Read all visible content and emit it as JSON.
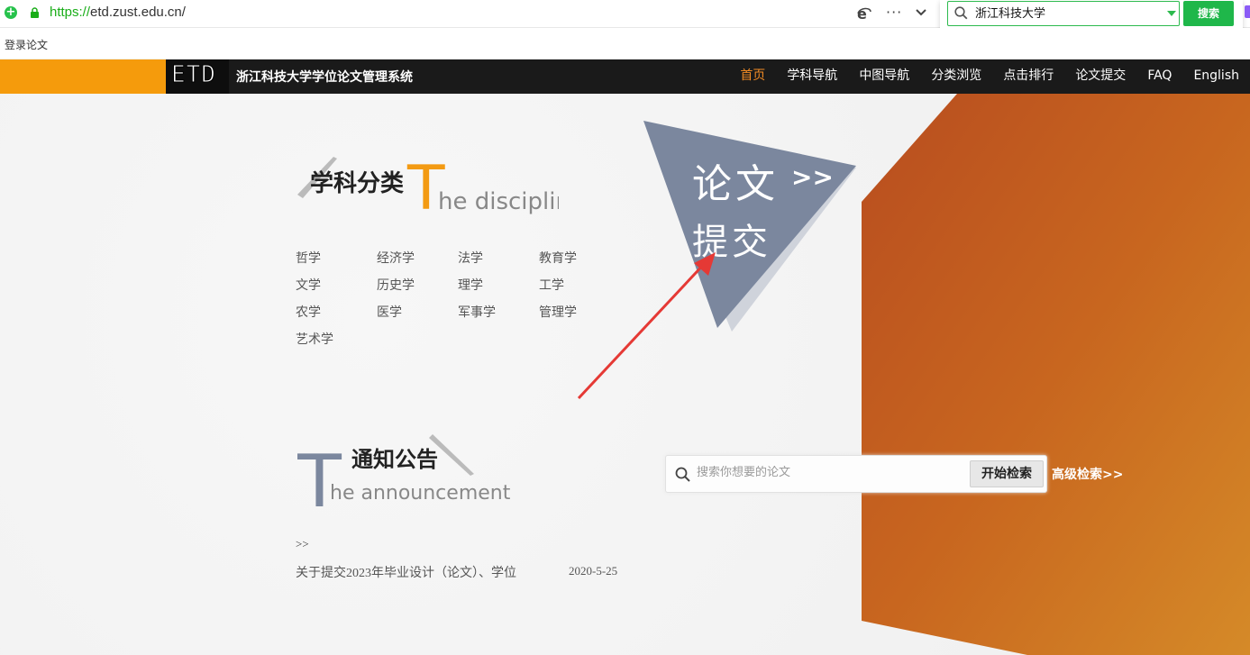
{
  "browser": {
    "url_scheme": "https://",
    "url_rest": "etd.zust.edu.cn/",
    "more_label": "···",
    "search_value": "浙江科技大学",
    "search_button": "搜索"
  },
  "bookmark": {
    "label": "登录论文"
  },
  "site": {
    "logo": "ETD",
    "title": "浙江科技大学学位论文管理系统",
    "nav": [
      "首页",
      "学科导航",
      "中图导航",
      "分类浏览",
      "点击排行",
      "论文提交",
      "FAQ",
      "English"
    ],
    "active_nav": 0
  },
  "discipline": {
    "heading_cn": "学科分类",
    "heading_t": "T",
    "heading_en": "he discipline",
    "categories": [
      "哲学",
      "经济学",
      "法学",
      "教育学",
      "文学",
      "历史学",
      "理学",
      "工学",
      "农学",
      "医学",
      "军事学",
      "管理学",
      "艺术学"
    ]
  },
  "submit": {
    "line1": "论文",
    "arrows": ">>",
    "line2": "提交"
  },
  "announcement": {
    "heading_cn": "通知公告",
    "heading_t": "T",
    "heading_en": "he announcement",
    "more": ">>",
    "items": [
      {
        "title": "关于提交2023年毕业设计（论文）、学位",
        "date": "2020-5-25"
      }
    ]
  },
  "search": {
    "placeholder": "搜索你想要的论文",
    "button": "开始检索",
    "advanced": "高级检索>>"
  },
  "colors": {
    "accent": "#f59b0c",
    "nav_bg": "#1a1a1a",
    "active_nav": "#f08a24",
    "triangle": "#7b879e",
    "orange_panel": "#c8641e",
    "search_green": "#1fb74a"
  }
}
